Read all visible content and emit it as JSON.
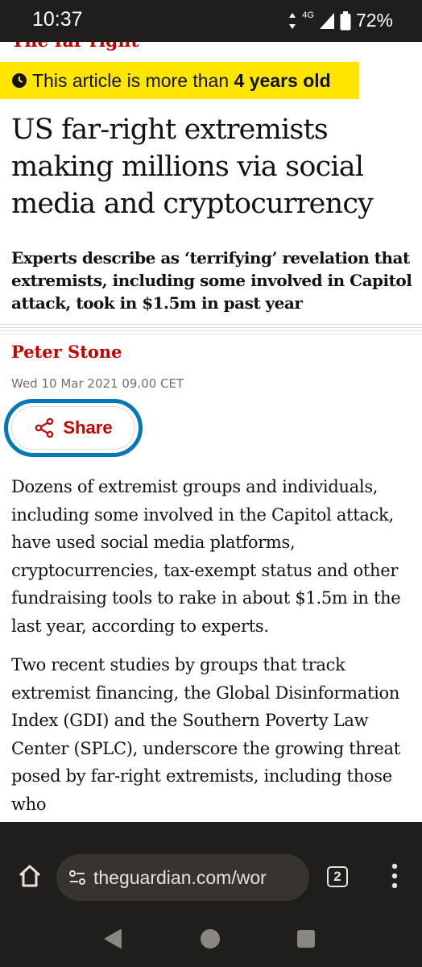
{
  "status_bar": {
    "time": "10:37",
    "network": "4G",
    "battery": "72%"
  },
  "article": {
    "section": "The far right",
    "age_notice_prefix": "This article is more than ",
    "age_notice_bold": "4 years old",
    "headline": "US far-right extremists making millions via social media and cryptocurrency",
    "standfirst": "Experts describe as ‘terrifying’ revelation that extremists, including some involved in Capitol attack, took in $1.5m in past year",
    "byline": "Peter Stone",
    "dateline": "Wed 10 Mar 2021 09.00 CET",
    "share_label": "Share",
    "paragraphs": [
      "Dozens of extremist groups and individuals, including some involved in the Capitol attack, have used social media platforms, cryptocurrencies, tax-exempt status and other fundraising tools to rake in about $1.5m in the last year, according to experts.",
      "Two recent studies by groups that track extremist financing, the Global Disinformation Index (GDI) and the Southern Poverty Law Center (SPLC), underscore the growing threat posed by far-right extremists, including those who"
    ]
  },
  "browser": {
    "url": "theguardian.com/wor",
    "tab_count": "2"
  },
  "colors": {
    "guardian_red": "#c70000",
    "age_banner": "#ffe500",
    "focus_ring": "#0077b6"
  },
  "icons": [
    "clock-icon",
    "share-icon",
    "home-icon",
    "site-settings-icon",
    "tabs-icon",
    "more-menu-icon",
    "back-icon",
    "home-nav-icon",
    "recents-icon",
    "signal-icon",
    "wifi-icon",
    "battery-icon"
  ]
}
